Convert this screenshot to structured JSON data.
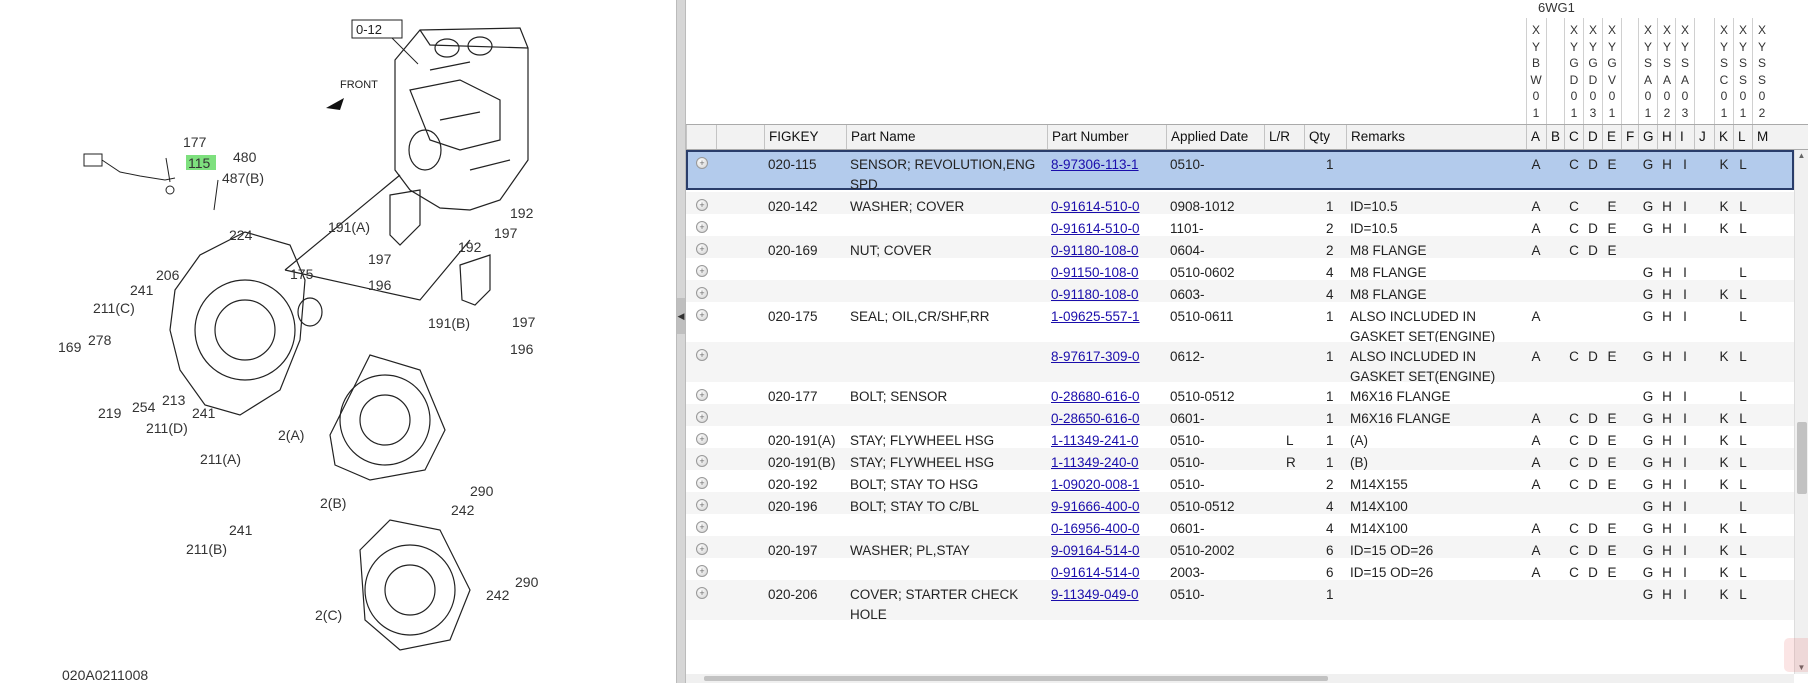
{
  "illustration": {
    "code": "020A0211008",
    "box_label": "0-12",
    "front_label": "FRONT",
    "highlight": "115",
    "callouts": [
      "177",
      "115",
      "480",
      "487(B)",
      "224",
      "206",
      "241",
      "211(C)",
      "169",
      "278",
      "219",
      "254",
      "213",
      "241",
      "211(D)",
      "211(A)",
      "241",
      "211(B)",
      "175",
      "2(A)",
      "2(B)",
      "2(C)",
      "191(A)",
      "197",
      "192",
      "197",
      "196",
      "191(B)",
      "192",
      "197",
      "197",
      "196",
      "290",
      "242",
      "242",
      "290"
    ]
  },
  "model": {
    "name": "6WG1",
    "variants": [
      {
        "code": "XYBW01"
      },
      {
        "code": ""
      },
      {
        "code": "XYGD01"
      },
      {
        "code": "XYGD03"
      },
      {
        "code": "XYGV01"
      },
      {
        "code": ""
      },
      {
        "code": "XYSA01"
      },
      {
        "code": "XYSA02"
      },
      {
        "code": "XYSA03"
      },
      {
        "code": ""
      },
      {
        "code": "XYSC01"
      },
      {
        "code": "XYSS01"
      },
      {
        "code": "XYSS02"
      }
    ]
  },
  "columns": {
    "figkey": "FIGKEY",
    "part_name": "Part Name",
    "part_number": "Part Number",
    "applied_date": "Applied Date",
    "lr": "L/R",
    "qty": "Qty",
    "remarks": "Remarks",
    "flags": [
      "A",
      "B",
      "C",
      "D",
      "E",
      "F",
      "G",
      "H",
      "I",
      "J",
      "K",
      "L",
      "M"
    ]
  },
  "rows": [
    {
      "figkey": "020-115",
      "name": "SENSOR; REVOLUTION,ENG SPD",
      "pn": "8-97306-113-1",
      "date": "0510-",
      "lr": "",
      "qty": "1",
      "remarks": "",
      "flags": [
        "A",
        "",
        "C",
        "D",
        "E",
        "",
        "G",
        "H",
        "I",
        "",
        "K",
        "L",
        ""
      ],
      "selected": true
    },
    {
      "figkey": "020-142",
      "name": "WASHER; COVER",
      "pn": "0-91614-510-0",
      "date": "0908-1012",
      "lr": "",
      "qty": "1",
      "remarks": "ID=10.5",
      "flags": [
        "A",
        "",
        "C",
        "",
        "E",
        "",
        "G",
        "H",
        "I",
        "",
        "K",
        "L",
        ""
      ]
    },
    {
      "figkey": "",
      "name": "",
      "pn": "0-91614-510-0",
      "date": "1101-",
      "lr": "",
      "qty": "2",
      "remarks": "ID=10.5",
      "flags": [
        "A",
        "",
        "C",
        "D",
        "E",
        "",
        "G",
        "H",
        "I",
        "",
        "K",
        "L",
        ""
      ]
    },
    {
      "figkey": "020-169",
      "name": "NUT; COVER",
      "pn": "0-91180-108-0",
      "date": "0604-",
      "lr": "",
      "qty": "2",
      "remarks": "M8 FLANGE",
      "flags": [
        "A",
        "",
        "C",
        "D",
        "E",
        "",
        "",
        "",
        "",
        "",
        "",
        "",
        ""
      ]
    },
    {
      "figkey": "",
      "name": "",
      "pn": "0-91150-108-0",
      "date": "0510-0602",
      "lr": "",
      "qty": "4",
      "remarks": "M8 FLANGE",
      "flags": [
        "",
        "",
        "",
        "",
        "",
        "",
        "G",
        "H",
        "I",
        "",
        "",
        "L",
        ""
      ]
    },
    {
      "figkey": "",
      "name": "",
      "pn": "0-91180-108-0",
      "date": "0603-",
      "lr": "",
      "qty": "4",
      "remarks": "M8 FLANGE",
      "flags": [
        "",
        "",
        "",
        "",
        "",
        "",
        "G",
        "H",
        "I",
        "",
        "K",
        "L",
        ""
      ]
    },
    {
      "figkey": "020-175",
      "name": "SEAL; OIL,CR/SHF,RR",
      "pn": "1-09625-557-1",
      "date": "0510-0611",
      "lr": "",
      "qty": "1",
      "remarks": "ALSO INCLUDED IN GASKET SET(ENGINE)",
      "flags": [
        "A",
        "",
        "",
        "",
        "",
        "",
        "G",
        "H",
        "I",
        "",
        "",
        "L",
        ""
      ]
    },
    {
      "figkey": "",
      "name": "",
      "pn": "8-97617-309-0",
      "date": "0612-",
      "lr": "",
      "qty": "1",
      "remarks": "ALSO INCLUDED IN GASKET SET(ENGINE)",
      "flags": [
        "A",
        "",
        "C",
        "D",
        "E",
        "",
        "G",
        "H",
        "I",
        "",
        "K",
        "L",
        ""
      ]
    },
    {
      "figkey": "020-177",
      "name": "BOLT; SENSOR",
      "pn": "0-28680-616-0",
      "date": "0510-0512",
      "lr": "",
      "qty": "1",
      "remarks": "M6X16 FLANGE",
      "flags": [
        "",
        "",
        "",
        "",
        "",
        "",
        "G",
        "H",
        "I",
        "",
        "",
        "L",
        ""
      ]
    },
    {
      "figkey": "",
      "name": "",
      "pn": "0-28650-616-0",
      "date": "0601-",
      "lr": "",
      "qty": "1",
      "remarks": "M6X16 FLANGE",
      "flags": [
        "A",
        "",
        "C",
        "D",
        "E",
        "",
        "G",
        "H",
        "I",
        "",
        "K",
        "L",
        ""
      ]
    },
    {
      "figkey": "020-191(A)",
      "name": "STAY; FLYWHEEL HSG",
      "pn": "1-11349-241-0",
      "date": "0510-",
      "lr": "L",
      "qty": "1",
      "remarks": "(A)",
      "flags": [
        "A",
        "",
        "C",
        "D",
        "E",
        "",
        "G",
        "H",
        "I",
        "",
        "K",
        "L",
        ""
      ]
    },
    {
      "figkey": "020-191(B)",
      "name": "STAY; FLYWHEEL HSG",
      "pn": "1-11349-240-0",
      "date": "0510-",
      "lr": "R",
      "qty": "1",
      "remarks": "(B)",
      "flags": [
        "A",
        "",
        "C",
        "D",
        "E",
        "",
        "G",
        "H",
        "I",
        "",
        "K",
        "L",
        ""
      ]
    },
    {
      "figkey": "020-192",
      "name": "BOLT; STAY TO HSG",
      "pn": "1-09020-008-1",
      "date": "0510-",
      "lr": "",
      "qty": "2",
      "remarks": "M14X155",
      "flags": [
        "A",
        "",
        "C",
        "D",
        "E",
        "",
        "G",
        "H",
        "I",
        "",
        "K",
        "L",
        ""
      ]
    },
    {
      "figkey": "020-196",
      "name": "BOLT; STAY TO C/BL",
      "pn": "9-91666-400-0",
      "date": "0510-0512",
      "lr": "",
      "qty": "4",
      "remarks": "M14X100",
      "flags": [
        "",
        "",
        "",
        "",
        "",
        "",
        "G",
        "H",
        "I",
        "",
        "",
        "L",
        ""
      ]
    },
    {
      "figkey": "",
      "name": "",
      "pn": "0-16956-400-0",
      "date": "0601-",
      "lr": "",
      "qty": "4",
      "remarks": "M14X100",
      "flags": [
        "A",
        "",
        "C",
        "D",
        "E",
        "",
        "G",
        "H",
        "I",
        "",
        "K",
        "L",
        ""
      ]
    },
    {
      "figkey": "020-197",
      "name": "WASHER; PL,STAY",
      "pn": "9-09164-514-0",
      "date": "0510-2002",
      "lr": "",
      "qty": "6",
      "remarks": "ID=15 OD=26",
      "flags": [
        "A",
        "",
        "C",
        "D",
        "E",
        "",
        "G",
        "H",
        "I",
        "",
        "K",
        "L",
        ""
      ]
    },
    {
      "figkey": "",
      "name": "",
      "pn": "0-91614-514-0",
      "date": "2003-",
      "lr": "",
      "qty": "6",
      "remarks": "ID=15 OD=26",
      "flags": [
        "A",
        "",
        "C",
        "D",
        "E",
        "",
        "G",
        "H",
        "I",
        "",
        "K",
        "L",
        ""
      ]
    },
    {
      "figkey": "020-206",
      "name": "COVER; STARTER CHECK HOLE",
      "pn": "9-11349-049-0",
      "date": "0510-",
      "lr": "",
      "qty": "1",
      "remarks": "",
      "flags": [
        "",
        "",
        "",
        "",
        "",
        "",
        "G",
        "H",
        "I",
        "",
        "K",
        "L",
        ""
      ]
    }
  ]
}
